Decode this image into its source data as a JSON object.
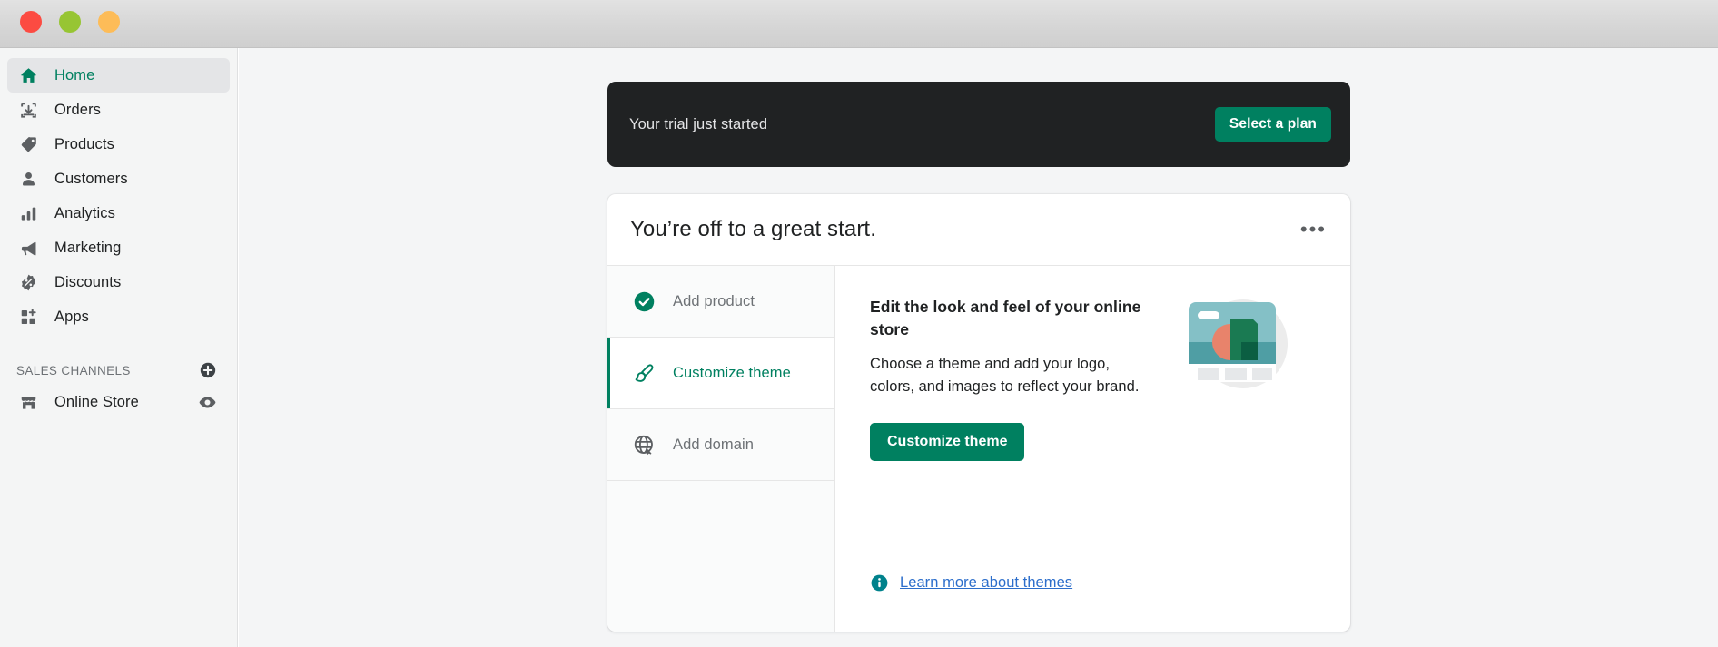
{
  "window": {
    "traffic_lights": [
      {
        "name": "close",
        "color": "#fc4b42"
      },
      {
        "name": "minimize",
        "color": "#97c533"
      },
      {
        "name": "maximize",
        "color": "#fdbc58"
      }
    ]
  },
  "sidebar": {
    "items": [
      {
        "label": "Home",
        "icon": "home-icon",
        "active": true
      },
      {
        "label": "Orders",
        "icon": "orders-icon",
        "active": false
      },
      {
        "label": "Products",
        "icon": "products-icon",
        "active": false
      },
      {
        "label": "Customers",
        "icon": "customers-icon",
        "active": false
      },
      {
        "label": "Analytics",
        "icon": "analytics-icon",
        "active": false
      },
      {
        "label": "Marketing",
        "icon": "marketing-icon",
        "active": false
      },
      {
        "label": "Discounts",
        "icon": "discounts-icon",
        "active": false
      },
      {
        "label": "Apps",
        "icon": "apps-icon",
        "active": false
      }
    ],
    "sales_channels": {
      "title": "SALES CHANNELS",
      "add_icon": "plus-circle-icon",
      "items": [
        {
          "label": "Online Store",
          "icon": "storefront-icon",
          "action_icon": "eye-icon"
        }
      ]
    },
    "active_color": "#008060"
  },
  "banner": {
    "text": "Your trial just started",
    "button_label": "Select a plan",
    "background": "#202223",
    "button_color": "#008060"
  },
  "card": {
    "title": "You’re off to a great start.",
    "menu_icon": "ellipsis-icon",
    "tasks": [
      {
        "label": "Add product",
        "icon": "check-circle-filled-icon",
        "state": "done"
      },
      {
        "label": "Customize theme",
        "icon": "paintbrush-icon",
        "state": "active"
      },
      {
        "label": "Add domain",
        "icon": "globe-icon",
        "state": "todo"
      }
    ],
    "detail": {
      "heading": "Edit the look and feel of your online store",
      "body": "Choose a theme and add your logo, colors, and images to reflect your brand.",
      "button_label": "Customize theme",
      "link_label": "Learn more about themes",
      "link_icon": "info-circle-icon",
      "link_color": "#2c6ecb",
      "illustration": "online-store-theme-illustration"
    }
  }
}
